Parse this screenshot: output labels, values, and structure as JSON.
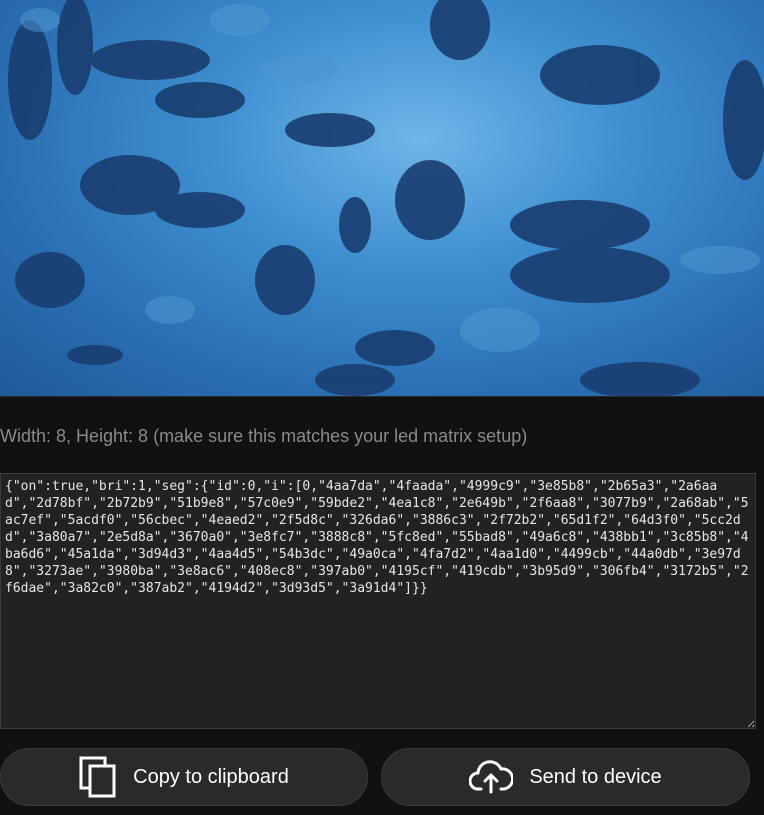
{
  "dimensions_text": "Width: 8, Height: 8 (make sure this matches your led matrix setup)",
  "json_output": "{\"on\":true,\"bri\":1,\"seg\":{\"id\":0,\"i\":[0,\"4aa7da\",\"4faada\",\"4999c9\",\"3e85b8\",\"2b65a3\",\"2a6aad\",\"2d78bf\",\"2b72b9\",\"51b9e8\",\"57c0e9\",\"59bde2\",\"4ea1c8\",\"2e649b\",\"2f6aa8\",\"3077b9\",\"2a68ab\",\"5ac7ef\",\"5acdf0\",\"56cbec\",\"4eaed2\",\"2f5d8c\",\"326da6\",\"3886c3\",\"2f72b2\",\"65d1f2\",\"64d3f0\",\"5cc2dd\",\"3a80a7\",\"2e5d8a\",\"3670a0\",\"3e8fc7\",\"3888c8\",\"5fc8ed\",\"55bad8\",\"49a6c8\",\"438bb1\",\"3c85b8\",\"4ba6d6\",\"45a1da\",\"3d94d3\",\"4aa4d5\",\"54b3dc\",\"49a0ca\",\"4fa7d2\",\"4aa1d0\",\"4499cb\",\"44a0db\",\"3e97d8\",\"3273ae\",\"3980ba\",\"3e8ac6\",\"408ec8\",\"397ab0\",\"4195cf\",\"419cdb\",\"3b95d9\",\"306fb4\",\"3172b5\",\"2f6dae\",\"3a82c0\",\"387ab2\",\"4194d2\",\"3d93d5\",\"3a91d4\"]}}",
  "buttons": {
    "copy_label": "Copy to clipboard",
    "send_label": "Send to device"
  },
  "icons": {
    "copy": "copy-icon",
    "send": "cloud-upload-icon"
  },
  "colors": {
    "background": "#111111",
    "button_bg": "#2a2a2a",
    "textarea_bg": "#222222",
    "muted_text": "#8a8a8a"
  }
}
